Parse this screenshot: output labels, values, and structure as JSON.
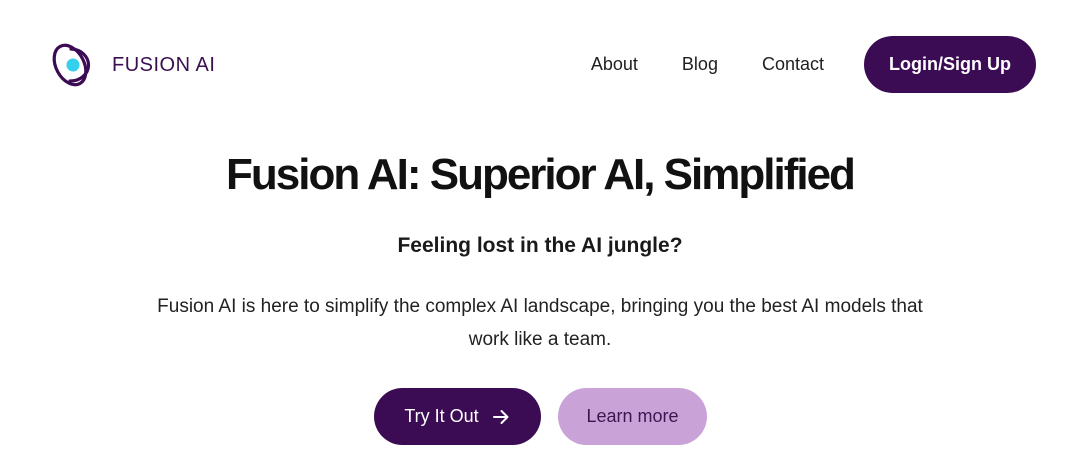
{
  "header": {
    "brand_name": "FUSION AI",
    "logo_icon": "fusion-orbit-logo",
    "nav": {
      "about": "About",
      "blog": "Blog",
      "contact": "Contact"
    },
    "login_label": "Login/Sign Up"
  },
  "hero": {
    "title": "Fusion AI: Superior AI, Simplified",
    "subtitle": "Feeling lost in the AI jungle?",
    "description": "Fusion AI is here to simplify the complex AI landscape, bringing you the best AI models that work like a team.",
    "primary_cta": "Try It Out",
    "primary_cta_icon": "arrow-right-icon",
    "secondary_cta": "Learn more"
  },
  "colors": {
    "brand_primary": "#3b0b54",
    "brand_secondary": "#c9a3d8",
    "logo_accent": "#35d0ee"
  }
}
